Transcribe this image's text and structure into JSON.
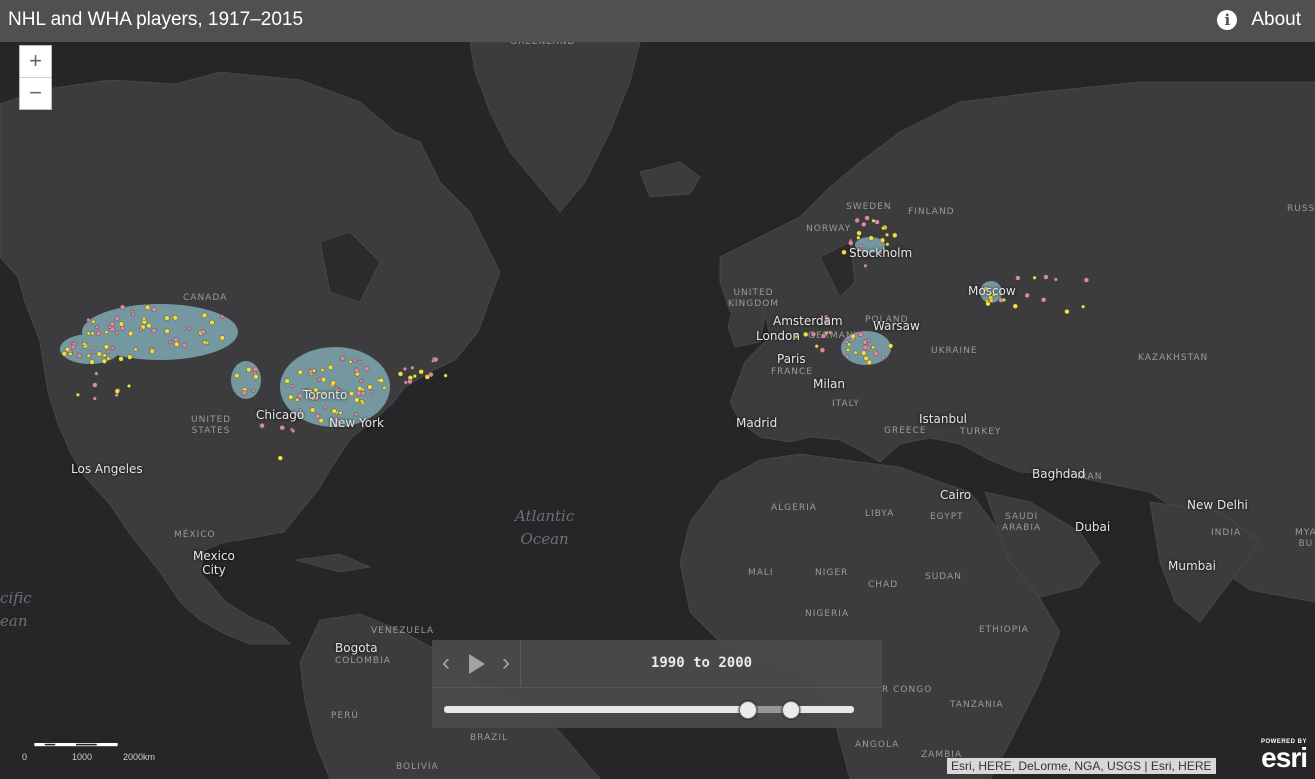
{
  "header": {
    "title": "NHL and WHA players, 1917–2015",
    "about_label": "About",
    "info_icon": "info-icon"
  },
  "zoom": {
    "in_label": "+",
    "out_label": "−"
  },
  "time_slider": {
    "range_label": "1990 to 2000",
    "prev_icon": "chevron-left-icon",
    "play_icon": "play-icon",
    "next_icon": "chevron-right-icon",
    "start_fraction": 0.74,
    "end_fraction": 0.845
  },
  "map": {
    "colors": {
      "land": "#3c3c3e",
      "water": "#262628",
      "halo": "#7fa8b1",
      "player_yellow": "#f3df3b",
      "player_pink": "#dd8aa0"
    },
    "cities": [
      {
        "name": "Los Angeles",
        "key": "los-angeles"
      },
      {
        "name": "Chicago",
        "key": "chicago"
      },
      {
        "name": "Toronto",
        "key": "toronto"
      },
      {
        "name": "New York",
        "key": "new-york"
      },
      {
        "name": "Mexico\nCity",
        "key": "mexico-city"
      },
      {
        "name": "Bogota",
        "key": "bogota"
      },
      {
        "name": "London",
        "key": "london"
      },
      {
        "name": "Amsterdam",
        "key": "amsterdam"
      },
      {
        "name": "Paris",
        "key": "paris"
      },
      {
        "name": "Madrid",
        "key": "madrid"
      },
      {
        "name": "Milan",
        "key": "milan"
      },
      {
        "name": "Warsaw",
        "key": "warsaw"
      },
      {
        "name": "Stockholm",
        "key": "stockholm"
      },
      {
        "name": "Moscow",
        "key": "moscow"
      },
      {
        "name": "Istanbul",
        "key": "istanbul"
      },
      {
        "name": "Cairo",
        "key": "cairo"
      },
      {
        "name": "Baghdad",
        "key": "baghdad"
      },
      {
        "name": "Dubai",
        "key": "dubai"
      },
      {
        "name": "New Delhi",
        "key": "new-delhi"
      },
      {
        "name": "Mumbai",
        "key": "mumbai"
      }
    ],
    "countries": [
      {
        "name": "GREENLAND",
        "key": "greenland"
      },
      {
        "name": "CANADA",
        "key": "canada"
      },
      {
        "name": "UNITED\nSTATES",
        "key": "united-states"
      },
      {
        "name": "MÉXICO",
        "key": "mexico"
      },
      {
        "name": "VENEZUELA",
        "key": "venezuela"
      },
      {
        "name": "COLOMBIA",
        "key": "colombia"
      },
      {
        "name": "PERÚ",
        "key": "peru"
      },
      {
        "name": "BRAZIL",
        "key": "brazil"
      },
      {
        "name": "BOLIVIA",
        "key": "bolivia"
      },
      {
        "name": "NORWAY",
        "key": "norway"
      },
      {
        "name": "SWEDEN",
        "key": "sweden"
      },
      {
        "name": "FINLAND",
        "key": "finland"
      },
      {
        "name": "UNITED\nKINGDOM",
        "key": "united-kingdom"
      },
      {
        "name": "GERMANY",
        "key": "germany"
      },
      {
        "name": "POLAND",
        "key": "poland"
      },
      {
        "name": "FRANCE",
        "key": "france"
      },
      {
        "name": "ITALY",
        "key": "italy"
      },
      {
        "name": "UKRAINE",
        "key": "ukraine"
      },
      {
        "name": "GREECE",
        "key": "greece"
      },
      {
        "name": "TURKEY",
        "key": "turkey"
      },
      {
        "name": "KAZAKHSTAN",
        "key": "kazakhstan"
      },
      {
        "name": "RUSSIA",
        "key": "russia"
      },
      {
        "name": "IRAN",
        "key": "iran"
      },
      {
        "name": "SAUDI\nARABIA",
        "key": "saudi-arabia"
      },
      {
        "name": "INDIA",
        "key": "india"
      },
      {
        "name": "MYA\nBU",
        "key": "myanmar"
      },
      {
        "name": "ALGERIA",
        "key": "algeria"
      },
      {
        "name": "LIBYA",
        "key": "libya"
      },
      {
        "name": "EGYPT",
        "key": "egypt"
      },
      {
        "name": "MALI",
        "key": "mali"
      },
      {
        "name": "NIGER",
        "key": "niger"
      },
      {
        "name": "CHAD",
        "key": "chad"
      },
      {
        "name": "SUDAN",
        "key": "sudan"
      },
      {
        "name": "NIGERIA",
        "key": "nigeria"
      },
      {
        "name": "ETHIOPIA",
        "key": "ethiopia"
      },
      {
        "name": "R CONGO",
        "key": "congo"
      },
      {
        "name": "TANZANIA",
        "key": "tanzania"
      },
      {
        "name": "ANGOLA",
        "key": "angola"
      },
      {
        "name": "ZAMBIA",
        "key": "zambia"
      }
    ],
    "oceans": [
      {
        "name": "Atlantic\nOcean",
        "key": "atlantic"
      },
      {
        "name": "cific\nean",
        "key": "pacific"
      }
    ]
  },
  "scale": {
    "labels": [
      "0",
      "1000",
      "2000km"
    ]
  },
  "attribution": "Esri, HERE, DeLorme, NGA, USGS | Esri, HERE",
  "logo": {
    "powered": "POWERED BY",
    "brand": "esri"
  }
}
